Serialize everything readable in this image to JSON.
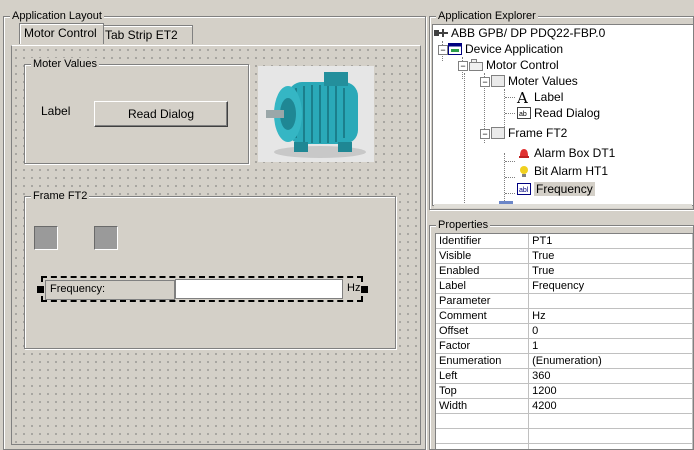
{
  "layout_panel": {
    "title": "Application Layout",
    "tabs": [
      {
        "label": "Motor Control",
        "active": true
      },
      {
        "label": "Tab Strip ET2",
        "active": false
      }
    ],
    "moter_values": {
      "title": "Moter Values",
      "label_text": "Label",
      "read_dialog_button": "Read Dialog"
    },
    "frame_ft2": {
      "title": "Frame FT2",
      "frequency_label": "Frequency:",
      "frequency_value": "",
      "frequency_unit": "Hz"
    }
  },
  "explorer": {
    "title": "Application Explorer",
    "nodes": [
      {
        "label": "ABB GPB/ DP PDQ22-FBP.0",
        "icon": "network-icon"
      },
      {
        "label": "Device Application",
        "icon": "application-icon"
      },
      {
        "label": "Motor Control",
        "icon": "tab-icon"
      },
      {
        "label": "Moter Values",
        "icon": "group-icon"
      },
      {
        "label": "Label",
        "icon": "text-label-icon"
      },
      {
        "label": "Read Dialog",
        "icon": "button-icon"
      },
      {
        "label": "Frame FT2",
        "icon": "group-icon"
      },
      {
        "label": "Alarm Box DT1",
        "icon": "alarm-bell-icon"
      },
      {
        "label": "Bit Alarm HT1",
        "icon": "bulb-icon"
      },
      {
        "label": "Frequency",
        "icon": "field-icon",
        "selected": true
      }
    ]
  },
  "properties": {
    "title": "Properties",
    "rows": [
      {
        "name": "Identifier",
        "value": "PT1"
      },
      {
        "name": "Visible",
        "value": "True"
      },
      {
        "name": "Enabled",
        "value": "True"
      },
      {
        "name": "Label",
        "value": "Frequency"
      },
      {
        "name": "Parameter",
        "value": ""
      },
      {
        "name": "Comment",
        "value": "Hz"
      },
      {
        "name": "Offset",
        "value": "0"
      },
      {
        "name": "Factor",
        "value": "1"
      },
      {
        "name": "Enumeration",
        "value": "(Enumeration)"
      },
      {
        "name": "Left",
        "value": "360"
      },
      {
        "name": "Top",
        "value": "1200"
      },
      {
        "name": "Width",
        "value": "4200"
      },
      {
        "name": "",
        "value": ""
      },
      {
        "name": "",
        "value": ""
      },
      {
        "name": "",
        "value": ""
      }
    ]
  },
  "colors": {
    "face": "#d4d0c8",
    "selection": "#d4d0c8",
    "motor_body": "#2aa9b8"
  }
}
